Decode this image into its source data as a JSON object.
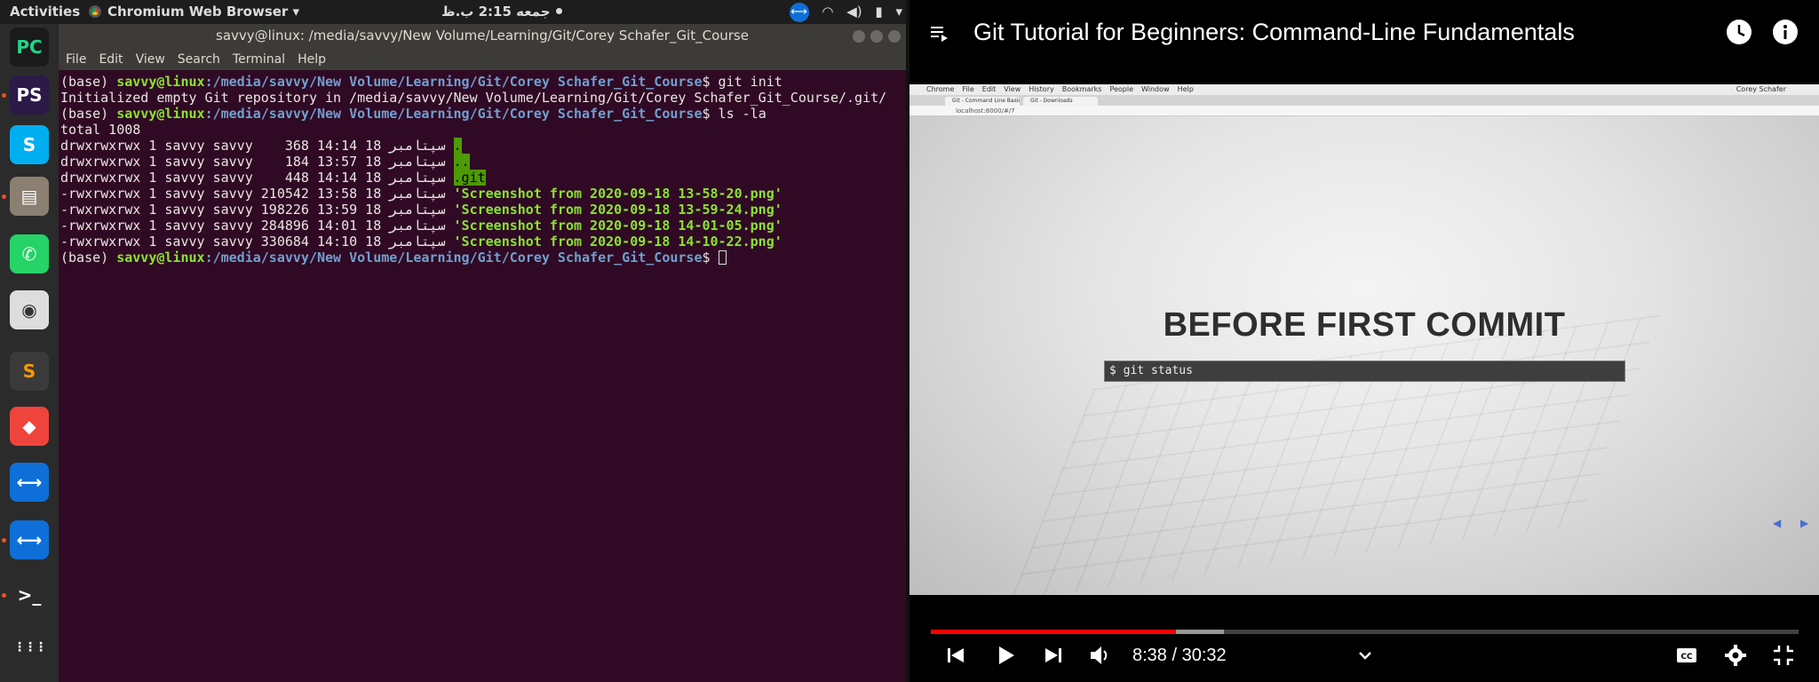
{
  "topbar": {
    "activities": "Activities",
    "app_menu": "Chromium Web Browser ▾",
    "clock": "جمعه 2:15 ب.ظ",
    "tray_menu": "▾"
  },
  "dock": {
    "items": [
      {
        "name": "pycharm",
        "label": "PC",
        "bg": "#1a1a1a",
        "fg": "#21d789"
      },
      {
        "name": "phpstorm",
        "label": "PS",
        "bg": "#2b1948",
        "fg": "#ffffff"
      },
      {
        "name": "skype",
        "label": "S",
        "bg": "#00aff0",
        "fg": "#ffffff"
      },
      {
        "name": "files",
        "label": "▤",
        "bg": "#8a7f70",
        "fg": "#ffffff"
      },
      {
        "name": "whatsapp",
        "label": "✆",
        "bg": "#25d366",
        "fg": "#ffffff"
      },
      {
        "name": "camera",
        "label": "◉",
        "bg": "#dddddd",
        "fg": "#333333"
      },
      {
        "name": "sublime",
        "label": "S",
        "bg": "#3a3a3a",
        "fg": "#ff9800"
      },
      {
        "name": "anydesk",
        "label": "◆",
        "bg": "#ef443b",
        "fg": "#ffffff"
      },
      {
        "name": "teamviewer",
        "label": "⟷",
        "bg": "#0e6fd8",
        "fg": "#ffffff"
      },
      {
        "name": "teamviewer-2",
        "label": "⟷",
        "bg": "#0e6fd8",
        "fg": "#ffffff"
      },
      {
        "name": "terminal",
        "label": ">_",
        "bg": "#2c2c2c",
        "fg": "#ffffff"
      },
      {
        "name": "show-apps",
        "label": "⋮⋮⋮",
        "bg": "transparent",
        "fg": "#ffffff"
      }
    ]
  },
  "terminal": {
    "title": "savvy@linux: /media/savvy/New Volume/Learning/Git/Corey Schafer_Git_Course",
    "menu": [
      "File",
      "Edit",
      "View",
      "Search",
      "Terminal",
      "Help"
    ],
    "prompt_base": "(base) ",
    "prompt_user": "savvy@linux",
    "prompt_path": ":/media/savvy/New Volume/Learning/Git/Corey Schafer_Git_Course",
    "cmd1": "$ git init",
    "out1": "Initialized empty Git repository in /media/savvy/New Volume/Learning/Git/Corey Schafer_Git_Course/.git/",
    "cmd2": "$ ls -la",
    "total": "total 1008",
    "dirs": [
      {
        "meta": "drwxrwxrwx 1 savvy savvy    368 سپتامبر 18 14:14 ",
        "name": "."
      },
      {
        "meta": "drwxrwxrwx 1 savvy savvy    184 سپتامبر 18 13:57 ",
        "name": ".."
      },
      {
        "meta": "drwxrwxrwx 1 savvy savvy    448 سپتامبر 18 14:14 ",
        "name": ".git"
      }
    ],
    "files": [
      {
        "meta": "-rwxrwxrwx 1 savvy savvy 210542 سپتامبر 18 13:58 ",
        "name": "'Screenshot from 2020-09-18 13-58-20.png'"
      },
      {
        "meta": "-rwxrwxrwx 1 savvy savvy 198226 سپتامبر 18 13:59 ",
        "name": "'Screenshot from 2020-09-18 13-59-24.png'"
      },
      {
        "meta": "-rwxrwxrwx 1 savvy savvy 284896 سپتامبر 18 14:01 ",
        "name": "'Screenshot from 2020-09-18 14-01-05.png'"
      },
      {
        "meta": "-rwxrwxrwx 1 savvy savvy 330684 سپتامبر 18 14:10 ",
        "name": "'Screenshot from 2020-09-18 14-10-22.png'"
      }
    ],
    "prompt_end": "$ "
  },
  "video": {
    "title": "Git Tutorial for Beginners: Command-Line Fundamentals",
    "mac_menu": [
      "",
      "Chrome",
      "File",
      "Edit",
      "View",
      "History",
      "Bookmarks",
      "People",
      "Window",
      "Help"
    ],
    "mac_user": "Corey Schafer",
    "mac_tabs": [
      "Git - Command Line Basic",
      "Git - Downloads"
    ],
    "mac_url": "localhost:8000/#/7",
    "slide_title": "BEFORE FIRST COMMIT",
    "slide_code": "$ git status",
    "slide_prev": "◀",
    "slide_next": "▶",
    "time_current": "8:38",
    "time_sep": " / ",
    "time_total": "30:32",
    "progress_played": 0.283,
    "progress_buffered": 0.338,
    "colors": {
      "played": "#ff0000"
    }
  }
}
